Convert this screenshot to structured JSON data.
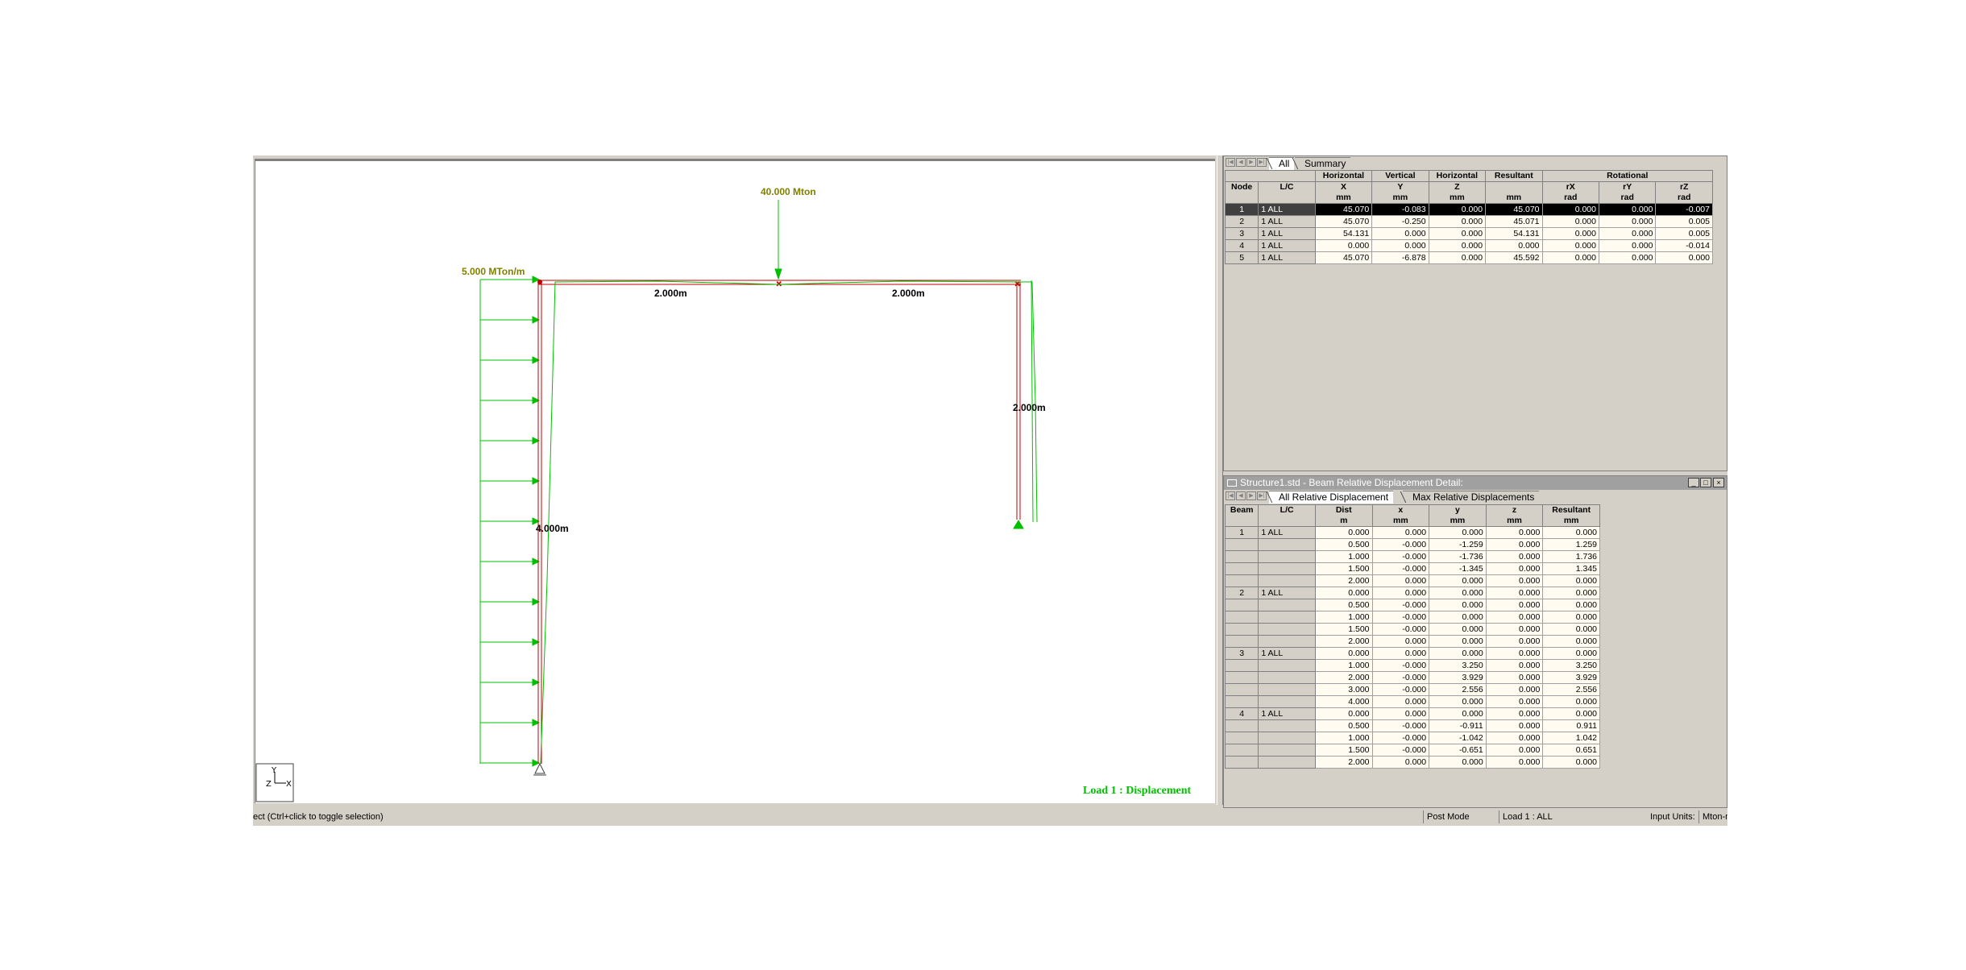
{
  "viewport": {
    "load_force_label": "40.000 Mton",
    "udl_label": "5.000 MTon/m",
    "dim_beam_left": "2.000m",
    "dim_beam_right": "2.000m",
    "dim_right_column": "2.000m",
    "dim_left_column": "4.000m",
    "result_caption": "Load 1 : Displacement",
    "axis_y": "Y",
    "axis_z": "Z",
    "axis_x": "X",
    "colors": {
      "structure": "#c00000",
      "load": "#00c000",
      "deflected": "#00c000",
      "label": "#808000"
    }
  },
  "node_panel": {
    "tabs": [
      "All",
      "Summary"
    ],
    "group_headers": [
      "Horizontal",
      "Vertical",
      "Horizontal",
      "Resultant",
      "Rotational"
    ],
    "columns": [
      {
        "name": "Node",
        "unit": ""
      },
      {
        "name": "L/C",
        "unit": ""
      },
      {
        "name": "X",
        "unit": "mm"
      },
      {
        "name": "Y",
        "unit": "mm"
      },
      {
        "name": "Z",
        "unit": "mm"
      },
      {
        "name": "",
        "unit": "mm"
      },
      {
        "name": "rX",
        "unit": "rad"
      },
      {
        "name": "rY",
        "unit": "rad"
      },
      {
        "name": "rZ",
        "unit": "rad"
      }
    ],
    "rows": [
      {
        "node": "1",
        "lc": "1 ALL",
        "x": "45.070",
        "y": "-0.083",
        "z": "0.000",
        "res": "45.070",
        "rx": "0.000",
        "ry": "0.000",
        "rz": "-0.007",
        "selected": true
      },
      {
        "node": "2",
        "lc": "1 ALL",
        "x": "45.070",
        "y": "-0.250",
        "z": "0.000",
        "res": "45.071",
        "rx": "0.000",
        "ry": "0.000",
        "rz": "0.005",
        "selected": false
      },
      {
        "node": "3",
        "lc": "1 ALL",
        "x": "54.131",
        "y": "0.000",
        "z": "0.000",
        "res": "54.131",
        "rx": "0.000",
        "ry": "0.000",
        "rz": "0.005",
        "selected": false
      },
      {
        "node": "4",
        "lc": "1 ALL",
        "x": "0.000",
        "y": "0.000",
        "z": "0.000",
        "res": "0.000",
        "rx": "0.000",
        "ry": "0.000",
        "rz": "-0.014",
        "selected": false
      },
      {
        "node": "5",
        "lc": "1 ALL",
        "x": "45.070",
        "y": "-6.878",
        "z": "0.000",
        "res": "45.592",
        "rx": "0.000",
        "ry": "0.000",
        "rz": "0.000",
        "selected": false
      }
    ]
  },
  "beam_panel": {
    "title": "Structure1.std - Beam Relative Displacement Detail:",
    "tabs": [
      "All Relative Displacement",
      "Max Relative Displacements"
    ],
    "columns": [
      {
        "name": "Beam",
        "unit": ""
      },
      {
        "name": "L/C",
        "unit": ""
      },
      {
        "name": "Dist",
        "unit": "m"
      },
      {
        "name": "x",
        "unit": "mm"
      },
      {
        "name": "y",
        "unit": "mm"
      },
      {
        "name": "z",
        "unit": "mm"
      },
      {
        "name": "Resultant",
        "unit": "mm"
      }
    ],
    "rows": [
      {
        "beam": "1",
        "lc": "1 ALL",
        "dist": "0.000",
        "x": "0.000",
        "y": "0.000",
        "z": "0.000",
        "res": "0.000"
      },
      {
        "beam": "",
        "lc": "",
        "dist": "0.500",
        "x": "-0.000",
        "y": "-1.259",
        "z": "0.000",
        "res": "1.259"
      },
      {
        "beam": "",
        "lc": "",
        "dist": "1.000",
        "x": "-0.000",
        "y": "-1.736",
        "z": "0.000",
        "res": "1.736"
      },
      {
        "beam": "",
        "lc": "",
        "dist": "1.500",
        "x": "-0.000",
        "y": "-1.345",
        "z": "0.000",
        "res": "1.345"
      },
      {
        "beam": "",
        "lc": "",
        "dist": "2.000",
        "x": "0.000",
        "y": "0.000",
        "z": "0.000",
        "res": "0.000"
      },
      {
        "beam": "2",
        "lc": "1 ALL",
        "dist": "0.000",
        "x": "0.000",
        "y": "0.000",
        "z": "0.000",
        "res": "0.000"
      },
      {
        "beam": "",
        "lc": "",
        "dist": "0.500",
        "x": "-0.000",
        "y": "0.000",
        "z": "0.000",
        "res": "0.000"
      },
      {
        "beam": "",
        "lc": "",
        "dist": "1.000",
        "x": "-0.000",
        "y": "0.000",
        "z": "0.000",
        "res": "0.000"
      },
      {
        "beam": "",
        "lc": "",
        "dist": "1.500",
        "x": "-0.000",
        "y": "0.000",
        "z": "0.000",
        "res": "0.000"
      },
      {
        "beam": "",
        "lc": "",
        "dist": "2.000",
        "x": "0.000",
        "y": "0.000",
        "z": "0.000",
        "res": "0.000"
      },
      {
        "beam": "3",
        "lc": "1 ALL",
        "dist": "0.000",
        "x": "0.000",
        "y": "0.000",
        "z": "0.000",
        "res": "0.000"
      },
      {
        "beam": "",
        "lc": "",
        "dist": "1.000",
        "x": "-0.000",
        "y": "3.250",
        "z": "0.000",
        "res": "3.250"
      },
      {
        "beam": "",
        "lc": "",
        "dist": "2.000",
        "x": "-0.000",
        "y": "3.929",
        "z": "0.000",
        "res": "3.929"
      },
      {
        "beam": "",
        "lc": "",
        "dist": "3.000",
        "x": "-0.000",
        "y": "2.556",
        "z": "0.000",
        "res": "2.556"
      },
      {
        "beam": "",
        "lc": "",
        "dist": "4.000",
        "x": "0.000",
        "y": "0.000",
        "z": "0.000",
        "res": "0.000"
      },
      {
        "beam": "4",
        "lc": "1 ALL",
        "dist": "0.000",
        "x": "0.000",
        "y": "0.000",
        "z": "0.000",
        "res": "0.000"
      },
      {
        "beam": "",
        "lc": "",
        "dist": "0.500",
        "x": "-0.000",
        "y": "-0.911",
        "z": "0.000",
        "res": "0.911"
      },
      {
        "beam": "",
        "lc": "",
        "dist": "1.000",
        "x": "-0.000",
        "y": "-1.042",
        "z": "0.000",
        "res": "1.042"
      },
      {
        "beam": "",
        "lc": "",
        "dist": "1.500",
        "x": "-0.000",
        "y": "-0.651",
        "z": "0.000",
        "res": "0.651"
      },
      {
        "beam": "",
        "lc": "",
        "dist": "2.000",
        "x": "0.000",
        "y": "0.000",
        "z": "0.000",
        "res": "0.000"
      }
    ]
  },
  "statusbar": {
    "hint": "ect (Ctrl+click to toggle selection)",
    "mode": "Post Mode",
    "load": "Load 1 : ALL",
    "units_label": "Input Units:",
    "units_value": "Mton-m"
  }
}
